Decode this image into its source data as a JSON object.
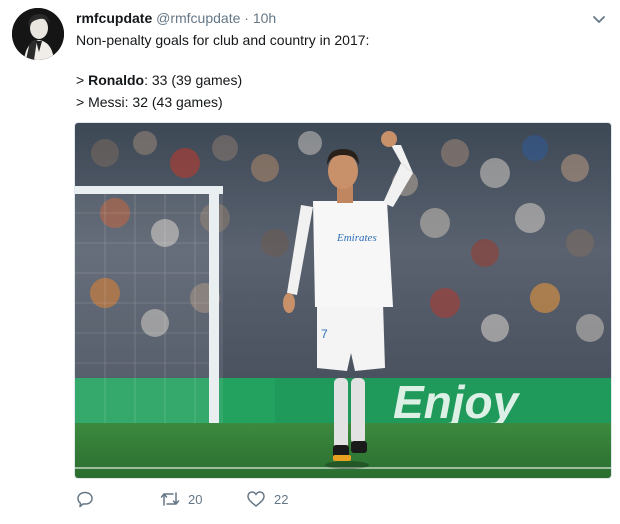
{
  "tweet": {
    "display_name": "rmfcupdate",
    "handle": "@rmfcupdate",
    "separator": "·",
    "time": "10h",
    "lines": {
      "intro": "Non-penalty goals for club and country in 2017:",
      "ronaldo_prefix": "> ",
      "ronaldo_name": "Ronaldo",
      "ronaldo_stats": ": 33 (39 games)",
      "messi": "> Messi: 32 (43 games)"
    },
    "media": {
      "jersey_text": "Emirates",
      "jersey_number": "7",
      "board_text": "Enjoy"
    },
    "actions": {
      "reply_count": "",
      "retweet_count": "20",
      "like_count": "22"
    }
  },
  "colors": {
    "text": "#14171a",
    "muted": "#657786",
    "pitch": "#2f7a3a",
    "board": "#1f9a5a"
  }
}
